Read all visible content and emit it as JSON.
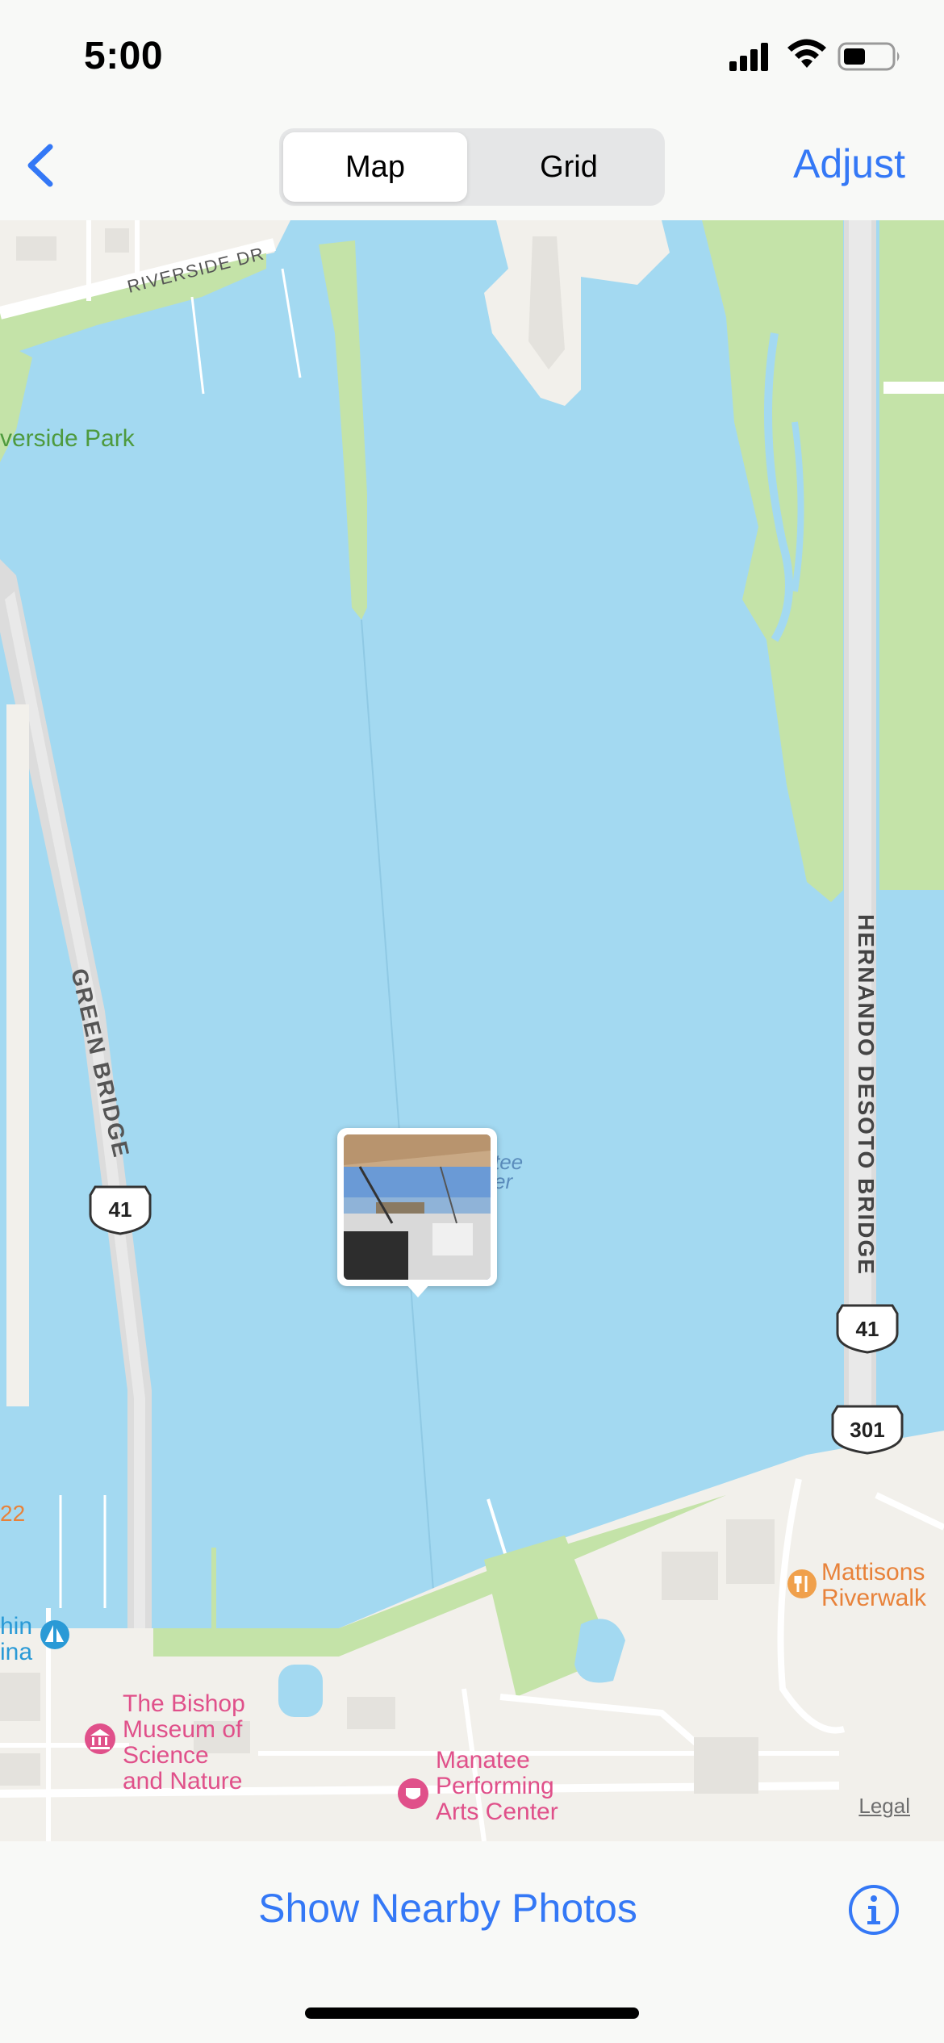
{
  "status_bar": {
    "time": "5:00",
    "icons": [
      "cellular-signal-icon",
      "wifi-icon",
      "battery-icon"
    ]
  },
  "nav": {
    "back_icon": "chevron-left-icon",
    "segments": [
      {
        "label": "Map",
        "selected": true
      },
      {
        "label": "Grid",
        "selected": false
      }
    ],
    "adjust_label": "Adjust"
  },
  "map": {
    "labels": {
      "riverside_dr": "RIVERSIDE DR",
      "riverside_park": "verside Park",
      "green_bridge": "GREEN BRIDGE",
      "hernando_desoto_bridge": "HERNANDO DESOTO BRIDGE",
      "manatee_river_partial_1": "tee",
      "manatee_river_partial_2": "er",
      "bishop_museum": [
        "The Bishop",
        "Museum of",
        "Science",
        "and Nature"
      ],
      "manatee_pac": [
        "Manatee",
        "Performing",
        "Arts Center"
      ],
      "mattisons": [
        "Mattisons",
        "Riverwalk"
      ],
      "marina_partial": [
        "hin",
        "ina"
      ],
      "route_partial": "22"
    },
    "shields": {
      "us41_left": "41",
      "us41_right": "41",
      "us301": "301"
    },
    "legal": "Legal",
    "colors": {
      "water": "#a3d9f1",
      "park": "#c4e3a8",
      "land": "#f2f0eb",
      "poi_pink": "#e0508a",
      "poi_orange": "#e8823a",
      "road": "#ffffff"
    }
  },
  "bottom": {
    "show_nearby_label": "Show Nearby Photos",
    "info_icon": "info-circle-icon"
  }
}
